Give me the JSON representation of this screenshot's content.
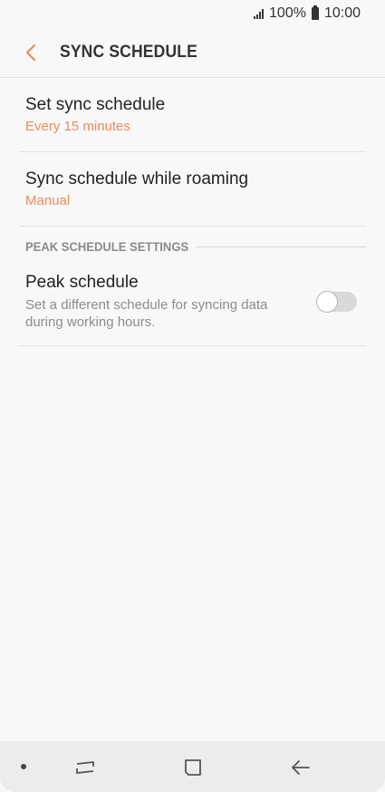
{
  "status_bar": {
    "battery_percent": "100%",
    "time": "10:00"
  },
  "header": {
    "title": "SYNC SCHEDULE",
    "back_icon": "chevron-left-icon"
  },
  "settings": {
    "sync_schedule": {
      "title": "Set sync schedule",
      "value": "Every 15 minutes"
    },
    "roaming": {
      "title": "Sync schedule while roaming",
      "value": "Manual"
    },
    "peak_section_header": "PEAK SCHEDULE SETTINGS",
    "peak_schedule": {
      "title": "Peak schedule",
      "description": "Set a different schedule for syncing data during working hours.",
      "enabled": false
    }
  },
  "colors": {
    "accent": "#ee8a5c",
    "background": "#f8f8f8",
    "divider": "#e2e2e2"
  },
  "nav_bar": {
    "icons": [
      "dot-icon",
      "recent-apps-icon",
      "home-icon",
      "back-arrow-icon"
    ]
  }
}
